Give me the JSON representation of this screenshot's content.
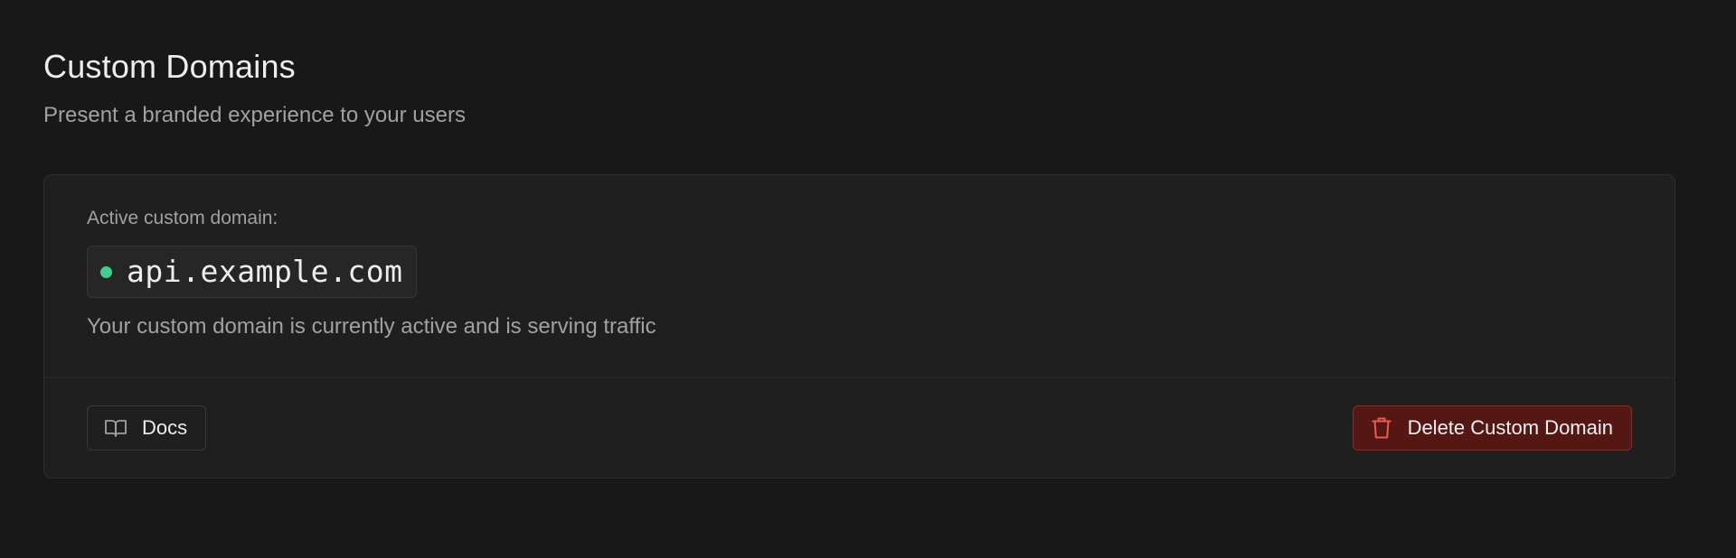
{
  "header": {
    "title": "Custom Domains",
    "subtitle": "Present a branded experience to your users"
  },
  "card": {
    "active_label": "Active custom domain:",
    "domain": "api.example.com",
    "status_message": "Your custom domain is currently active and is serving traffic",
    "status_color": "#3ecf8e"
  },
  "footer": {
    "docs_label": "Docs",
    "docs_icon": "book-open-icon",
    "delete_label": "Delete Custom Domain",
    "delete_icon": "trash-icon",
    "danger_color": "#e5484d"
  }
}
